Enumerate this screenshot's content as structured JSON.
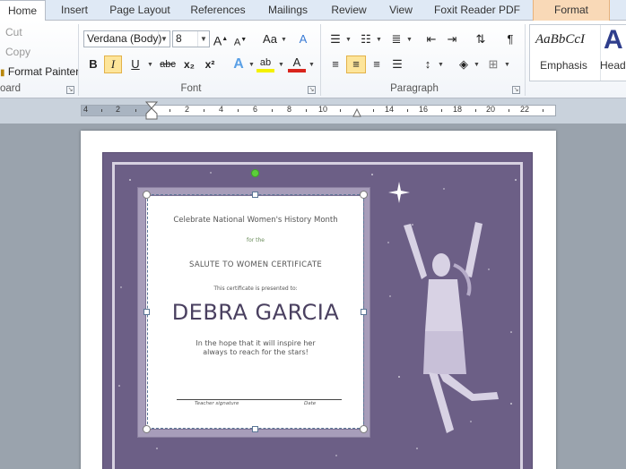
{
  "tabs": [
    {
      "label": "Home"
    },
    {
      "label": "Insert"
    },
    {
      "label": "Page Layout"
    },
    {
      "label": "References"
    },
    {
      "label": "Mailings"
    },
    {
      "label": "Review"
    },
    {
      "label": "View"
    },
    {
      "label": "Foxit Reader PDF"
    },
    {
      "label": "Format"
    }
  ],
  "clipboard": {
    "cut": "Cut",
    "copy": "Copy",
    "format_painter": "Format Painter",
    "group_label": "oard"
  },
  "font": {
    "family": "Verdana (Body)",
    "size": "8",
    "group_label": "Font",
    "bold": "B",
    "italic": "I",
    "underline": "U",
    "strike": "abc",
    "subscript": "x₂",
    "superscript": "x²",
    "grow": "A",
    "shrink": "A",
    "change_case": "Aa",
    "clear_format": "A",
    "text_effects": "A",
    "highlight": "ab",
    "font_color": "A"
  },
  "paragraph": {
    "group_label": "Paragraph",
    "pilcrow": "¶"
  },
  "styles": {
    "sample": "AaBbCcI",
    "emphasis": "Emphasis",
    "heading_partial_sample": "A",
    "heading_partial": "Head"
  },
  "ruler": {
    "labels": [
      "4",
      "2",
      "2",
      "4",
      "6",
      "8",
      "10",
      "14",
      "16",
      "18",
      "20",
      "22"
    ]
  },
  "certificate": {
    "heading": "Celebrate National Women's History Month",
    "for": "for the",
    "title": "SALUTE TO WOMEN CERTIFICATE",
    "presented": "This certificate is presented to:",
    "name": "DEBRA GARCIA",
    "hope_line1": "In the hope that it will inspire her",
    "hope_line2": "always to reach for the stars!",
    "sig_label": "Teacher signature",
    "date_label": "Date"
  },
  "colors": {
    "frame": "#6c5f86",
    "card": "#a79dba",
    "selected_button": "#fde59a",
    "format_tab": "#f9d9b7"
  }
}
